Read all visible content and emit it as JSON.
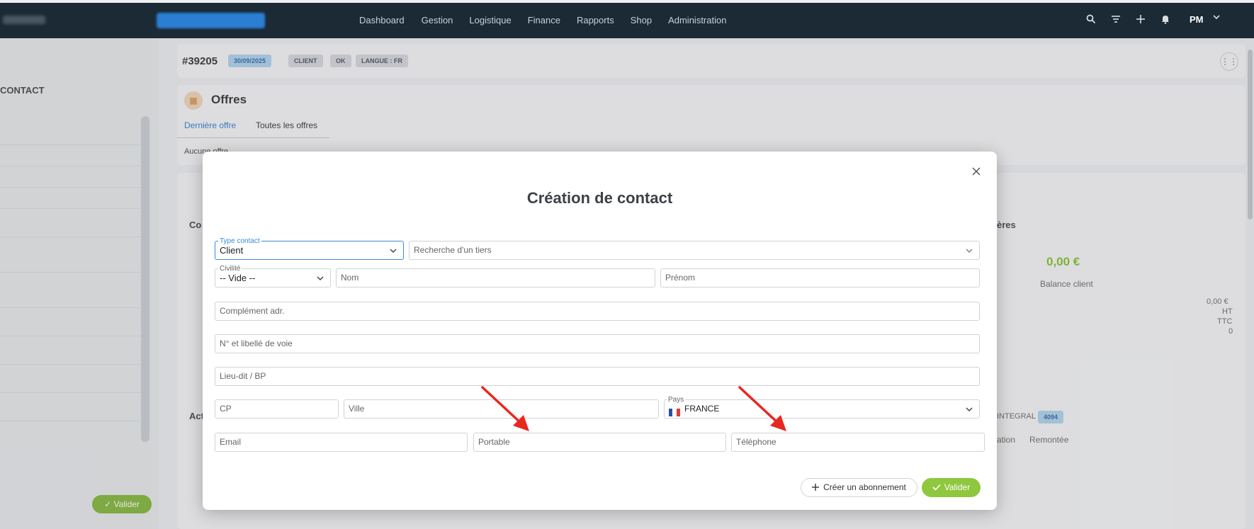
{
  "nav": {
    "items": [
      "Dashboard",
      "Gestion",
      "Logistique",
      "Finance",
      "Rapports",
      "Shop",
      "Administration"
    ],
    "user_initials": "PM"
  },
  "icons": {
    "search": "search-icon",
    "filter": "filter-icon",
    "add": "plus-icon",
    "bell": "bell-icon",
    "chevron": "chevron-down-icon",
    "grid": "grid-icon",
    "close": "close-icon",
    "check": "check-icon"
  },
  "record": {
    "id": "#39205",
    "date": "30/09/2025",
    "type": "CLIENT",
    "status": "OK",
    "language": "LANGUE : FR"
  },
  "offres": {
    "title": "Offres",
    "tab_last": "Dernière offre",
    "tab_all": "Toutes les offres",
    "empty": "Aucune offre"
  },
  "background": {
    "balance_amount": "0,00 €",
    "balance_label": "Balance client",
    "side_values": [
      "0,00 €",
      "HT",
      "TTC",
      "0"
    ],
    "integral_label": "INTEGRAL",
    "integral_count": "4094",
    "tab_remontee": "Remontée",
    "tab_ation": "ation",
    "card_co": "Co",
    "card_act": "Act",
    "card_fin": "ères",
    "left_valider": "Valider"
  },
  "modal": {
    "title": "Création de contact",
    "type_contact_label": "Type contact",
    "type_contact_value": "Client",
    "tiers_placeholder": "Recherche d'un tiers",
    "civilite_label": "Civilité",
    "civilite_value": "-- Vide --",
    "nom_placeholder": "Nom",
    "prenom_placeholder": "Prénom",
    "complement_placeholder": "Complément adr.",
    "voie_placeholder": "N° et libellé de voie",
    "lieudit_placeholder": "Lieu-dit / BP",
    "cp_placeholder": "CP",
    "ville_placeholder": "Ville",
    "pays_label": "Pays",
    "pays_value": "FRANCE",
    "email_placeholder": "Email",
    "portable_placeholder": "Portable",
    "telephone_placeholder": "Téléphone",
    "btn_abonnement": "Créer un abonnement",
    "btn_valider": "Valider"
  },
  "colors": {
    "navbar": "#1b2a35",
    "accent_blue": "#3a8ad6",
    "success_green": "#8fc73e",
    "arrow_red": "#e8271f"
  }
}
